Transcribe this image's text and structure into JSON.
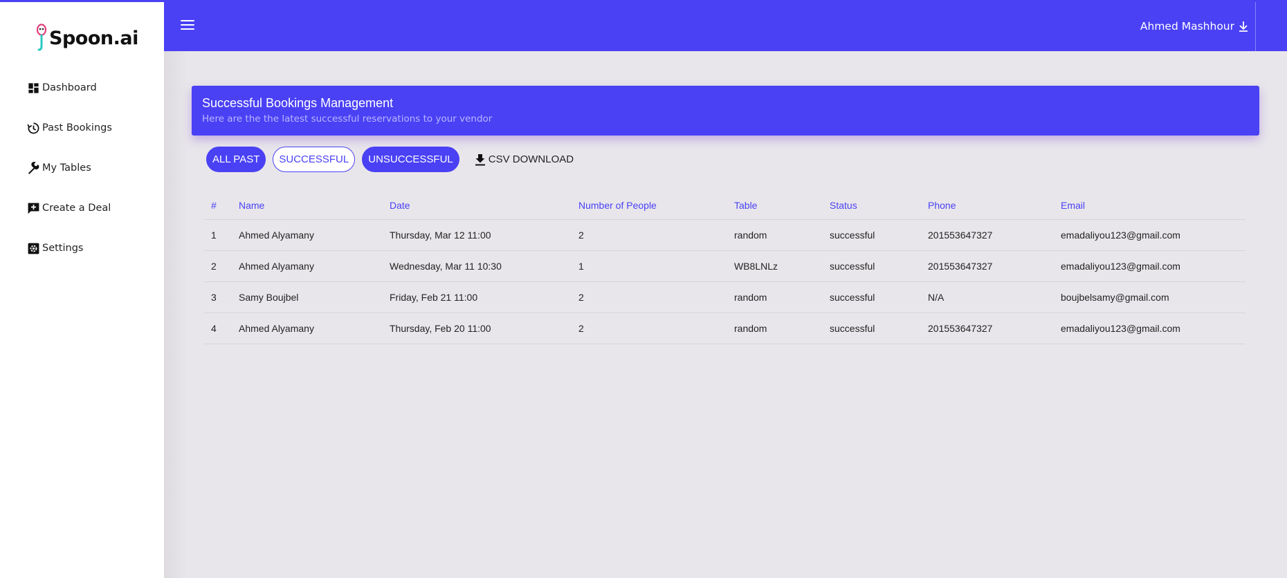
{
  "brand": {
    "name": "Spoon.ai"
  },
  "sidebar": {
    "items": [
      {
        "label": "Dashboard",
        "icon": "dashboard-icon"
      },
      {
        "label": "Past Bookings",
        "icon": "history-icon"
      },
      {
        "label": "My Tables",
        "icon": "wrench-icon"
      },
      {
        "label": "Create a Deal",
        "icon": "chat-plus-icon"
      },
      {
        "label": "Settings",
        "icon": "gear-icon"
      }
    ]
  },
  "header": {
    "user_name": "Ahmed Mashhour",
    "accent": "#4a41f5"
  },
  "card": {
    "title": "Successful Bookings Management",
    "subtitle": "Here are the the latest successful reservations to your vendor"
  },
  "filters": {
    "all_past": "ALL PAST",
    "successful": "SUCCESSFUL",
    "unsuccessful": "UNSUCCESSFUL",
    "csv": "CSV DOWNLOAD"
  },
  "table": {
    "headers": [
      "#",
      "Name",
      "Date",
      "Number of People",
      "Table",
      "Status",
      "Phone",
      "Email"
    ],
    "rows": [
      [
        "1",
        "Ahmed Alyamany",
        "Thursday, Mar 12 11:00",
        "2",
        "random",
        "successful",
        "201553647327",
        "emadaliyou123@gmail.com"
      ],
      [
        "2",
        "Ahmed Alyamany",
        "Wednesday, Mar 11 10:30",
        "1",
        "WB8LNLz",
        "successful",
        "201553647327",
        "emadaliyou123@gmail.com"
      ],
      [
        "3",
        "Samy Boujbel",
        "Friday, Feb 21 11:00",
        "2",
        "random",
        "successful",
        "N/A",
        "boujbelsamy@gmail.com"
      ],
      [
        "4",
        "Ahmed Alyamany",
        "Thursday, Feb 20 11:00",
        "2",
        "random",
        "successful",
        "201553647327",
        "emadaliyou123@gmail.com"
      ]
    ]
  }
}
